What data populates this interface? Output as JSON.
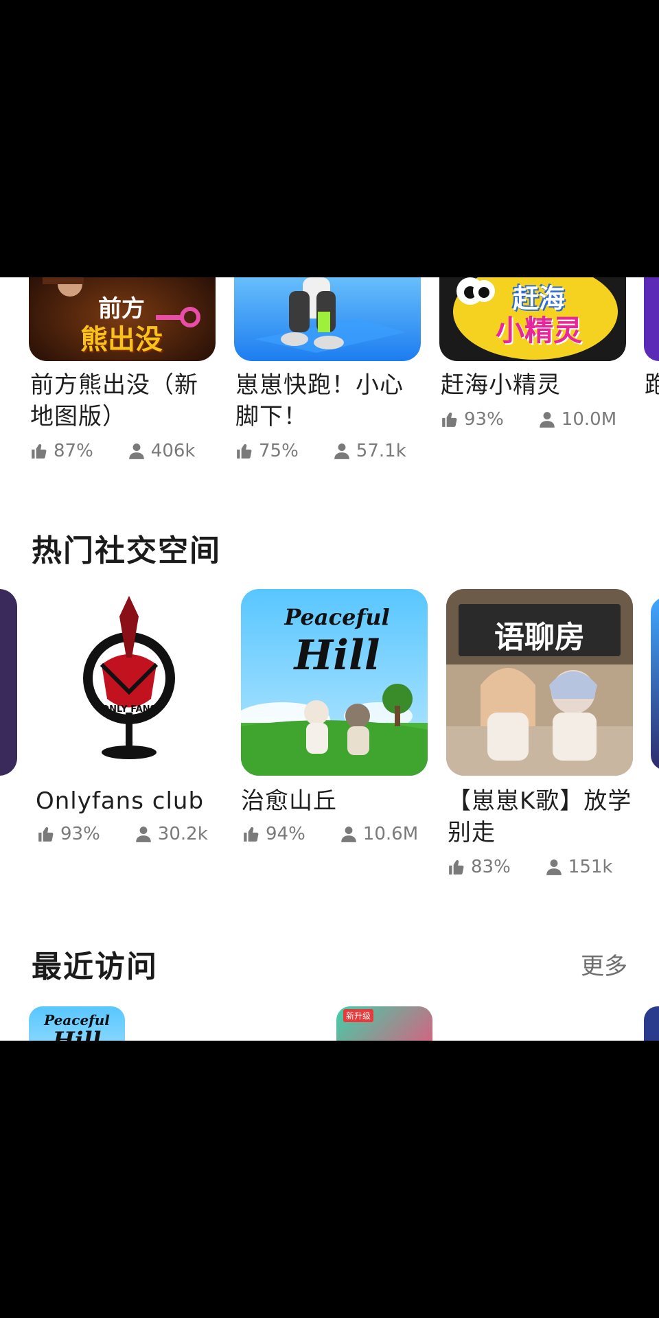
{
  "row1": [
    {
      "title": "前方熊出没（新地图版）",
      "thumb_text_1": "前方",
      "thumb_text_2": "熊出没",
      "likes": "87%",
      "players": "406k"
    },
    {
      "title": "崽崽快跑！小心脚下！",
      "likes": "75%",
      "players": "57.1k"
    },
    {
      "title": "赶海小精灵",
      "thumb_text_1": "赶海",
      "thumb_text_2": "小精灵",
      "likes": "93%",
      "players": "10.0M"
    },
    {
      "title": "跑"
    }
  ],
  "social_section": {
    "title": "热门社交空间",
    "items": [
      {
        "title": "Onlyfans club",
        "thumb_text": "ONLY FANS",
        "likes": "93%",
        "players": "30.2k"
      },
      {
        "title": "治愈山丘",
        "thumb_text_1": "Peaceful",
        "thumb_text_2": "Hill",
        "likes": "94%",
        "players": "10.6M"
      },
      {
        "title": "【崽崽K歌】放学别走",
        "thumb_text": "语聊房",
        "likes": "83%",
        "players": "151k"
      }
    ]
  },
  "recent_section": {
    "title": "最近访问",
    "more_label": "更多",
    "items": [
      {
        "thumb_text_1": "Peaceful",
        "thumb_text_2": "Hill"
      },
      {
        "badge": "新升级"
      },
      {}
    ]
  },
  "colors": {
    "accent_blue": "#3fa8ff",
    "text": "#1f1f1f",
    "meta": "#7a7a7a"
  }
}
